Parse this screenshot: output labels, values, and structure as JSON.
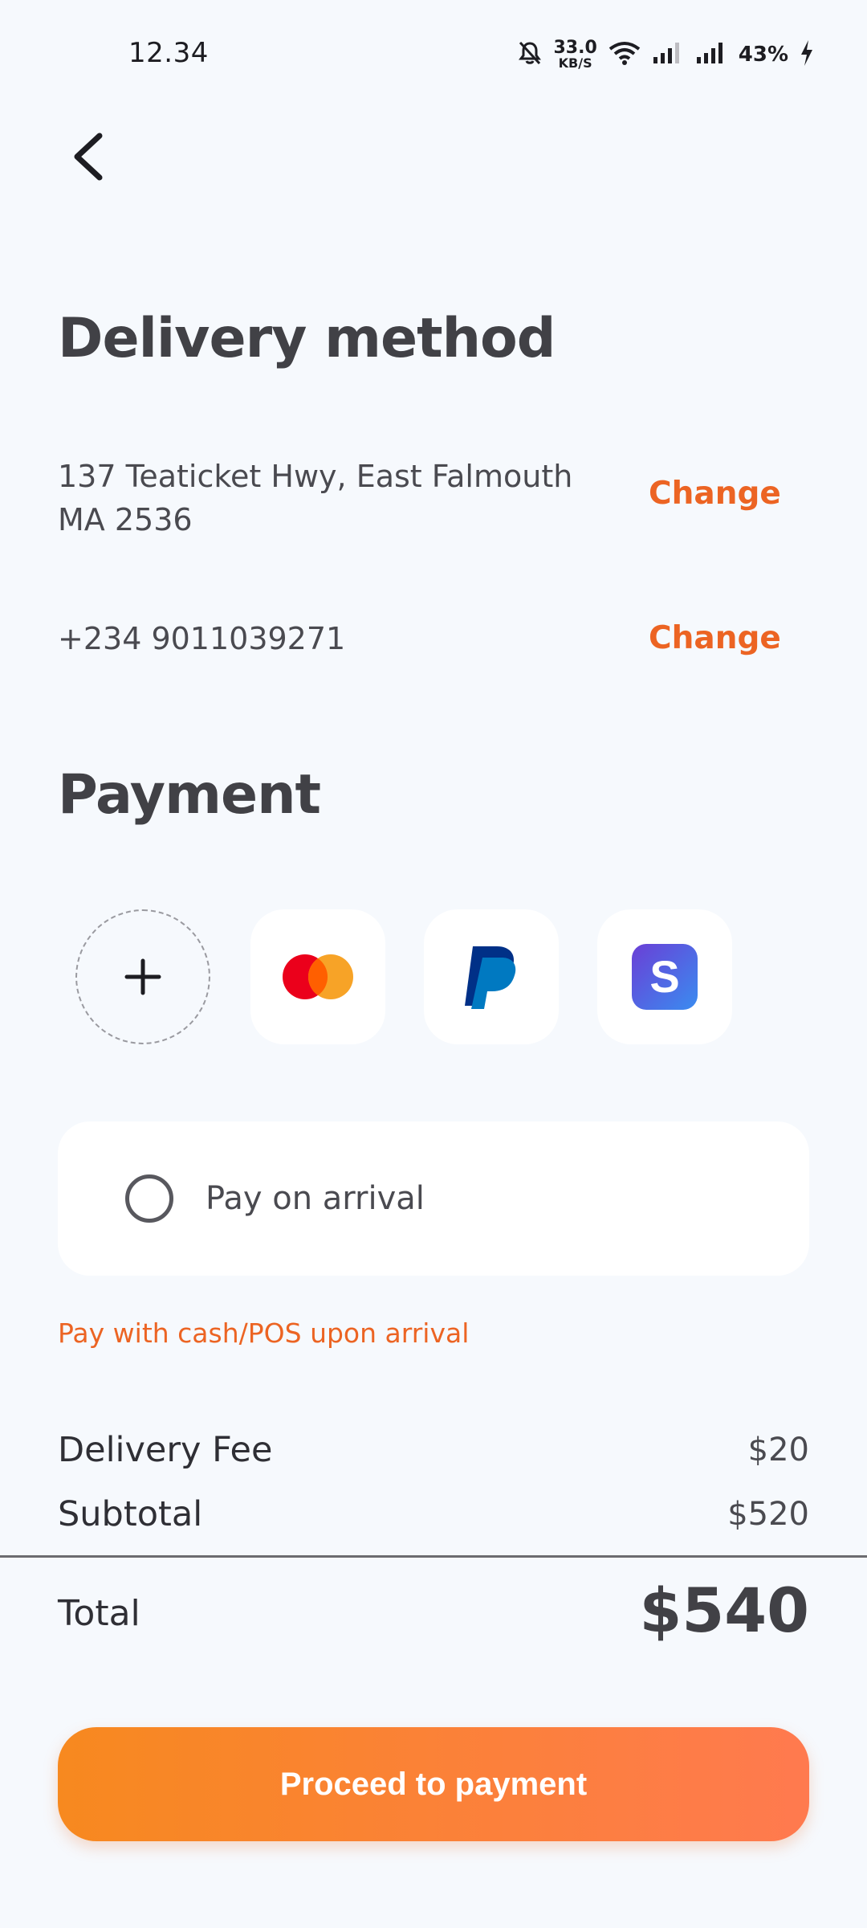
{
  "status_bar": {
    "time": "12.34",
    "net_speed_value": "33.0",
    "net_speed_unit": "KB/S",
    "battery": "43%",
    "icons": [
      "mute-bell-icon",
      "wifi-icon",
      "signal-icon",
      "signal-icon",
      "charging-icon"
    ]
  },
  "header": {
    "back_icon": "chevron-left-icon"
  },
  "delivery": {
    "title": "Delivery method",
    "address_line1": "137 Teaticket Hwy, East Falmouth",
    "address_line2": "MA 2536",
    "phone": "+234 9011039271",
    "change_label": "Change"
  },
  "payment": {
    "title": "Payment",
    "methods": [
      {
        "name": "add-card",
        "icon": "plus-icon"
      },
      {
        "name": "mastercard",
        "icon": "mastercard-icon"
      },
      {
        "name": "paypal",
        "icon": "paypal-icon"
      },
      {
        "name": "s-pay",
        "icon": "s-app-icon"
      }
    ],
    "arrival_option": "Pay on arrival",
    "arrival_note": "Pay with cash/POS upon arrival"
  },
  "summary": {
    "delivery_fee_label": "Delivery Fee",
    "delivery_fee": "$20",
    "subtotal_label": "Subtotal",
    "subtotal": "$520",
    "total_label": "Total",
    "total": "$540"
  },
  "cta": {
    "label": "Proceed to payment"
  },
  "colors": {
    "accent": "#ec6423",
    "button_start": "#f7891f",
    "button_end": "#ff7a4f",
    "background": "#f6f9fd"
  }
}
